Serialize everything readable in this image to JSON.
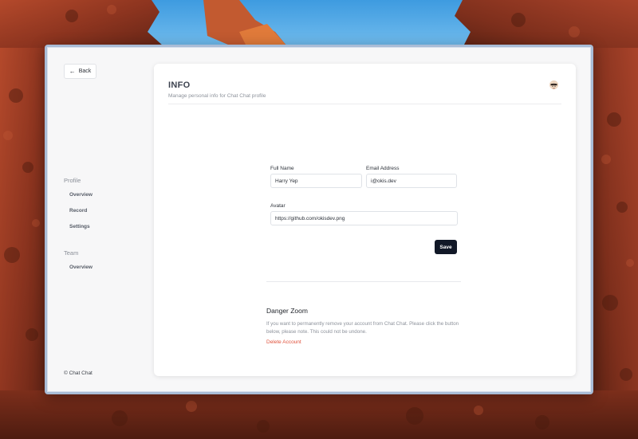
{
  "colors": {
    "accent": "#111827",
    "danger": "#e0533d",
    "window_border": "#a9bcd6"
  },
  "sidebar": {
    "back_label": "Back",
    "back_icon": "arrow-left-icon",
    "sections": [
      {
        "label": "Profile",
        "items": [
          {
            "label": "Overview"
          },
          {
            "label": "Record"
          },
          {
            "label": "Settings"
          }
        ]
      },
      {
        "label": "Team",
        "items": [
          {
            "label": "Overview"
          }
        ]
      }
    ],
    "copyright": "© Chat Chat"
  },
  "header": {
    "title": "INFO",
    "subtitle": "Manage personal info for Chat Chat profile",
    "avatar_icon": "user-avatar"
  },
  "form": {
    "full_name": {
      "label": "Full Name",
      "value": "Harry Yep"
    },
    "email": {
      "label": "Email Address",
      "value": "i@okis.dev"
    },
    "avatar": {
      "label": "Avatar",
      "value": "https://github.com/okisdev.png"
    },
    "save_label": "Save"
  },
  "danger": {
    "title": "Danger Zoom",
    "text": "If you want to permanently remove your account from Chat Chat. Please click the button below, please note. This could not be undone.",
    "delete_label": "Delete Account"
  }
}
